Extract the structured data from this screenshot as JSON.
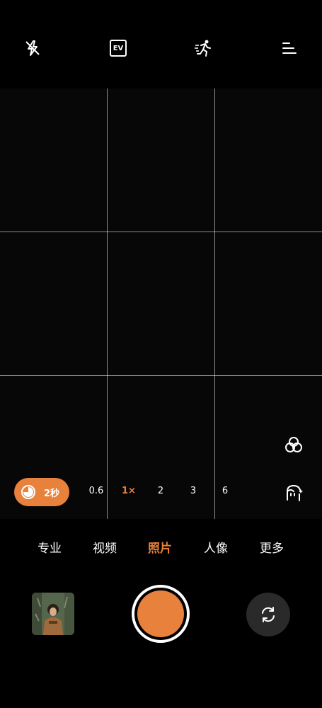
{
  "top_bar": {
    "flash_icon": "flash-off-icon",
    "ev_label": "EV",
    "motion_icon": "running-person-icon",
    "menu_icon": "menu-icon"
  },
  "side_controls": {
    "filter_icon": "filter-circles-icon",
    "beauty_icon": "face-beauty-icon"
  },
  "timer": {
    "icon": "timer-icon",
    "label": "2秒"
  },
  "zoom_levels": [
    {
      "label": "0.6",
      "active": false
    },
    {
      "label": "1×",
      "active": true
    },
    {
      "label": "2",
      "active": false
    },
    {
      "label": "3",
      "active": false
    },
    {
      "label": "6",
      "active": false
    }
  ],
  "modes": [
    {
      "label": "专业",
      "active": false
    },
    {
      "label": "视频",
      "active": false
    },
    {
      "label": "照片",
      "active": true
    },
    {
      "label": "人像",
      "active": false
    },
    {
      "label": "更多",
      "active": false
    }
  ],
  "bottom": {
    "gallery_icon": "gallery-thumbnail",
    "shutter_icon": "shutter-button",
    "switch_icon": "switch-camera-icon"
  },
  "colors": {
    "accent": "#E8813B",
    "background": "#000000",
    "grid": "#8c8c8c"
  }
}
